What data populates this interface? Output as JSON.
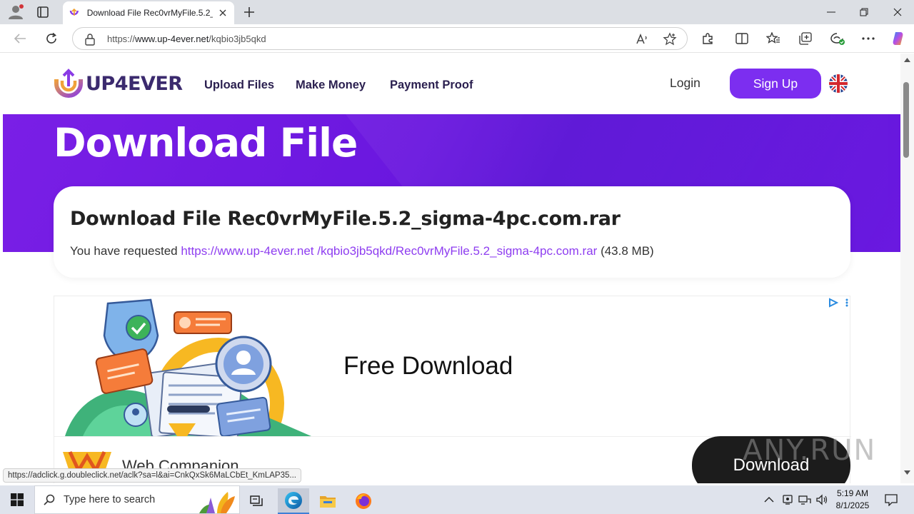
{
  "browser": {
    "tab_title": "Download File Rec0vrMyFile.5.2_sigma-4pc.com.rar",
    "url_prefix": "https://",
    "url_host": "www.up-4ever.net",
    "url_path": "/kqbio3jb5qkd"
  },
  "site": {
    "logo_text": "UP4EVER",
    "nav": [
      "Upload Files",
      "Make Money",
      "Payment Proof"
    ],
    "login": "Login",
    "signup": "Sign Up"
  },
  "hero": {
    "title": "Download File"
  },
  "file_card": {
    "heading": "Download File Rec0vrMyFile.5.2_sigma-4pc.com.rar",
    "requested_prefix": "You have requested",
    "link_text": "https://www.up-4ever.net /kqbio3jb5qkd/Rec0vrMyFile.5.2_sigma-4pc.com.rar",
    "size": "(43.8 MB)"
  },
  "ad": {
    "headline": "Free Download",
    "product": "Web Companion",
    "button": "Download"
  },
  "status_url": "https://adclick.g.doubleclick.net/aclk?sa=l&ai=CnkQxSk6MaLCbEt_KmLAP35...",
  "watermark": "ANY.RUN",
  "taskbar": {
    "search_placeholder": "Type here to search",
    "time": "5:19 AM",
    "date": "8/1/2025"
  },
  "colors": {
    "brand_purple": "#7c2ef0",
    "hero_purple": "#6a17df",
    "link_purple": "#8e3df0"
  }
}
